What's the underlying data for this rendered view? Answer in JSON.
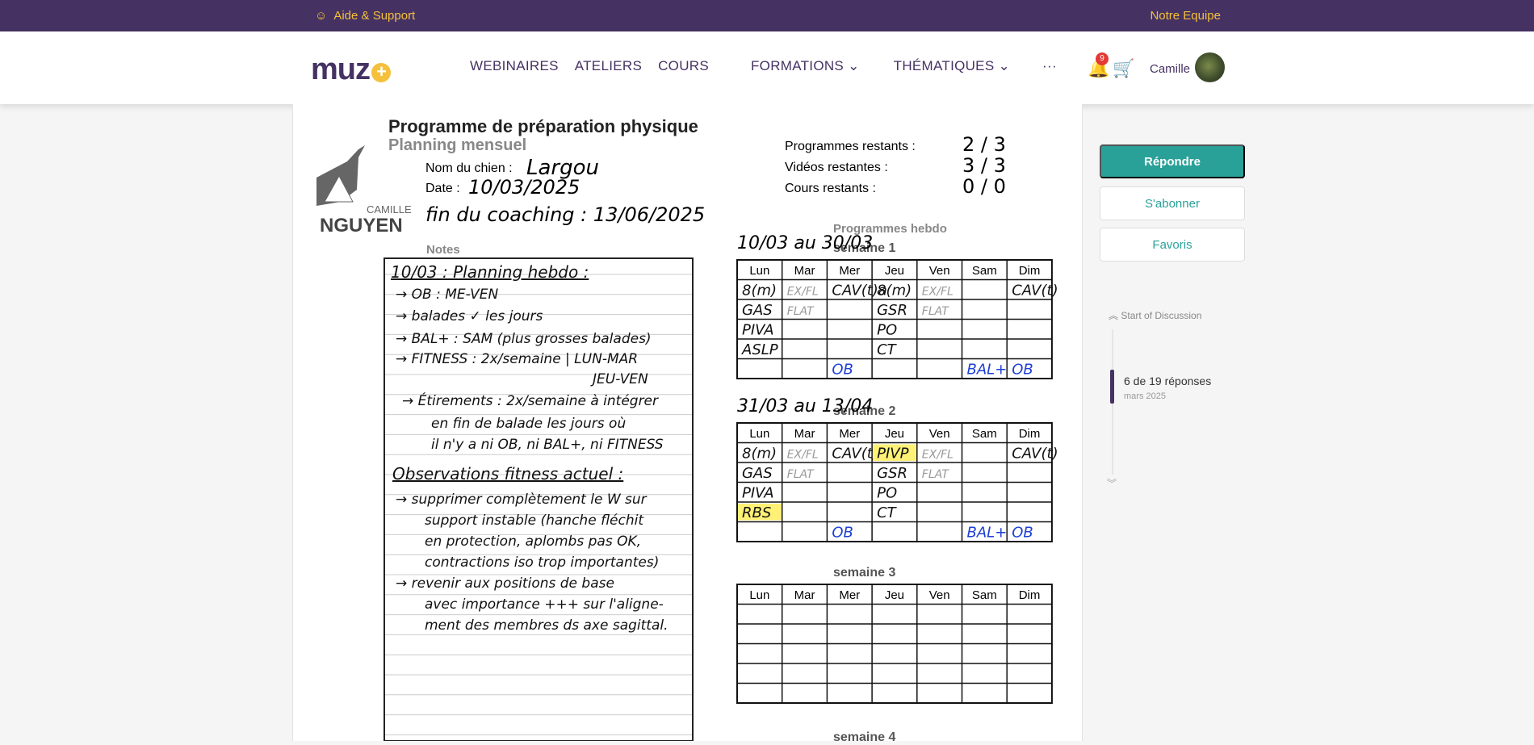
{
  "topbar": {
    "support": "Aide & Support",
    "team": "Notre Equipe"
  },
  "header": {
    "logo": "muz",
    "nav": [
      "WEBINAIRES",
      "ATELIERS",
      "COURS",
      "FORMATIONS",
      "THÉMATIQUES",
      "···"
    ],
    "notification_count": "9",
    "user": "Camille"
  },
  "document": {
    "title": "Programme de préparation physique",
    "subtitle": "Planning mensuel",
    "brand_top": "CAMILLE",
    "brand_bottom": "NGUYEN",
    "dog_label": "Nom du chien :",
    "dog_value": "Largou",
    "date_label": "Date :",
    "date_value": "10/03/2025",
    "end_label": "fin du coaching :",
    "end_value": "13/06/2025",
    "notes_label": "Notes",
    "remaining": [
      {
        "label": "Programmes restants :",
        "value": "2 / 3"
      },
      {
        "label": "Vidéos restantes :",
        "value": "3 / 3"
      },
      {
        "label": "Cours restants :",
        "value": "0 / 0"
      }
    ],
    "weekly_label": "Programmes hebdo",
    "notes_lines": [
      "10/03 : Planning hebdo :",
      "→ OB : ME-VEN",
      "→ balades ✓ les jours",
      "→ BAL+ : SAM (plus grosses balades)",
      "→ FITNESS : 2x/semaine | LUN-MAR",
      "JEU-VEN",
      "→ Étirements : 2x/semaine à intégrer",
      "en fin de balade les jours où",
      "il n'y a ni OB, ni BAL+, ni FITNESS",
      "Observations fitness actuel :",
      "→ supprimer complètement le W sur",
      "support instable (hanche fléchit",
      "en protection, aplombs pas OK,",
      "contractions iso trop importantes)",
      "→ revenir aux positions de base",
      "avec importance +++ sur l'aligne-",
      "ment des membres ds axe sagittal."
    ],
    "days": [
      "Lun",
      "Mar",
      "Mer",
      "Jeu",
      "Ven",
      "Sam",
      "Dim"
    ],
    "weeks": [
      {
        "label": "semaine 1",
        "range": "10/03 au 30/03",
        "rows": [
          [
            "8(m)",
            "EX/FL",
            "CAV(t)a",
            "8(m)",
            "EX/FL",
            "",
            "CAV(t)a"
          ],
          [
            "GAS",
            "FLAT",
            "",
            "GSR",
            "FLAT",
            "",
            ""
          ],
          [
            "PIVA",
            "",
            "",
            "PO",
            "",
            "",
            ""
          ],
          [
            "ASLP",
            "",
            "",
            "CT",
            "",
            "",
            ""
          ],
          [
            "",
            "",
            "OB",
            "",
            "",
            "BAL+",
            "OB"
          ]
        ]
      },
      {
        "label": "semaine 2",
        "range": "31/03 au 13/04",
        "rows": [
          [
            "8(m)",
            "EX/FL",
            "CAV(t)a",
            "PIVP",
            "EX/FL",
            "",
            "CAV(t)a"
          ],
          [
            "GAS",
            "FLAT",
            "",
            "GSR",
            "FLAT",
            "",
            ""
          ],
          [
            "PIVA",
            "",
            "",
            "PO",
            "",
            "",
            ""
          ],
          [
            "RBS",
            "",
            "",
            "CT",
            "",
            "",
            ""
          ],
          [
            "",
            "",
            "OB",
            "",
            "",
            "BAL+",
            "OB"
          ]
        ]
      },
      {
        "label": "semaine 3",
        "range": "",
        "rows": [
          [
            "",
            "",
            "",
            "",
            "",
            "",
            ""
          ],
          [
            "",
            "",
            "",
            "",
            "",
            "",
            ""
          ],
          [
            "",
            "",
            "",
            "",
            "",
            "",
            ""
          ],
          [
            "",
            "",
            "",
            "",
            "",
            "",
            ""
          ],
          [
            "",
            "",
            "",
            "",
            "",
            "",
            ""
          ]
        ]
      },
      {
        "label": "semaine 4",
        "range": "",
        "rows": []
      }
    ]
  },
  "sidebar": {
    "reply": "Répondre",
    "subscribe": "S'abonner",
    "favorites": "Favoris",
    "start": "Start of Discussion",
    "position": "6 de 19 réponses",
    "date": "mars 2025"
  },
  "colors": {
    "primary": "#453263",
    "accent": "#f5c03a",
    "teal": "#2aa198",
    "blue_ink": "#1f3fd6",
    "highlight": "#fff176"
  }
}
